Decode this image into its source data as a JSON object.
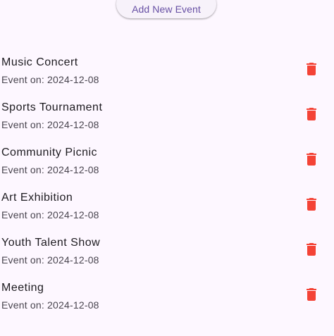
{
  "header": {
    "add_button_label": "Add New Event"
  },
  "colors": {
    "background": "#fdf7ff",
    "accent": "#6750a4",
    "delete_icon": "#f44336"
  },
  "event_date_prefix": "Event on: ",
  "events": [
    {
      "title": "Music Concert",
      "date": "2024-12-08",
      "action_icon": "delete-icon"
    },
    {
      "title": "Sports Tournament",
      "date": "2024-12-08",
      "action_icon": "delete-icon"
    },
    {
      "title": "Community Picnic",
      "date": "2024-12-08",
      "action_icon": "delete-icon"
    },
    {
      "title": "Art Exhibition",
      "date": "2024-12-08",
      "action_icon": "delete-icon"
    },
    {
      "title": "Youth Talent Show",
      "date": "2024-12-08",
      "action_icon": "delete-icon"
    },
    {
      "title": "Meeting",
      "date": "2024-12-08",
      "action_icon": "delete-icon"
    }
  ]
}
